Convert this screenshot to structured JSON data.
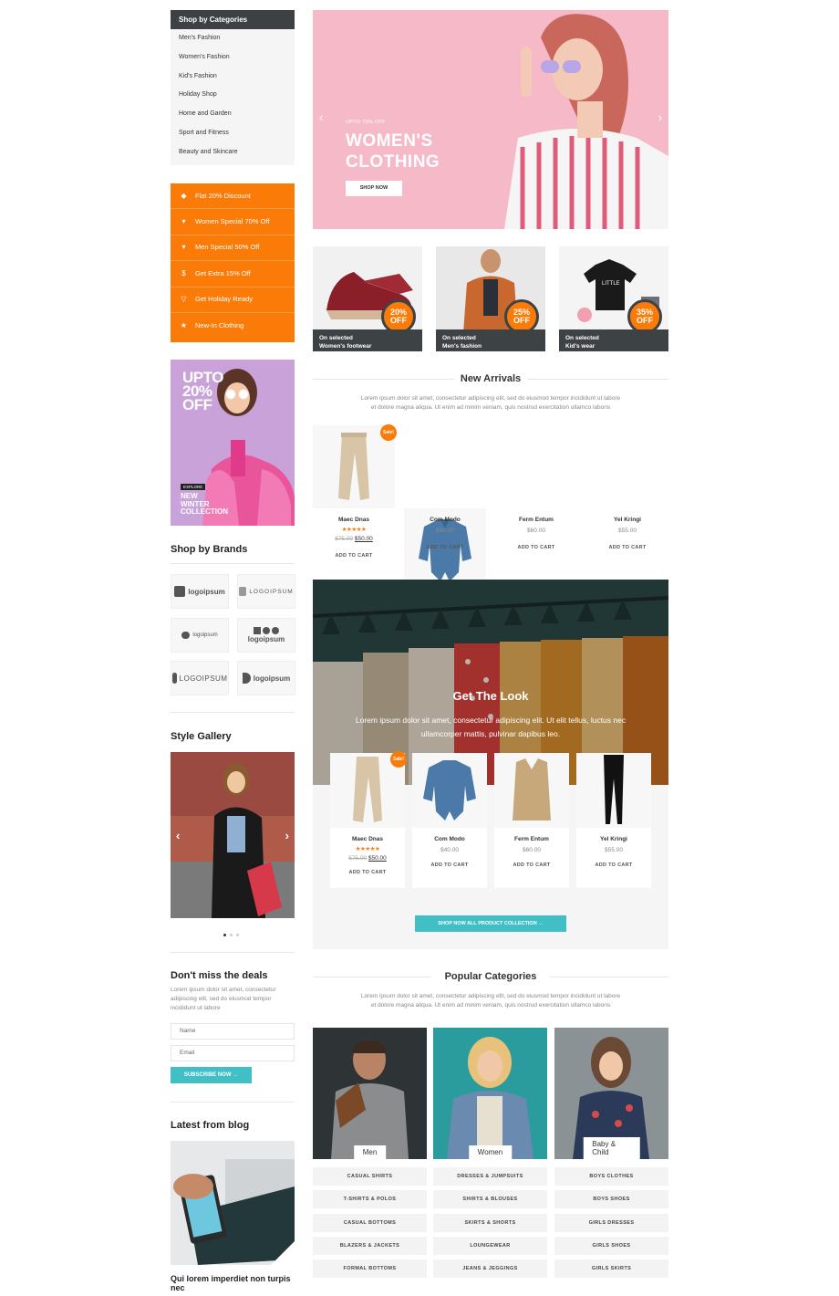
{
  "sidebar": {
    "categories_title": "Shop by Categories",
    "categories": [
      "Men's Fashion",
      "Women's Fashion",
      "Kid's Fashion",
      "Holiday Shop",
      "Home and Garden",
      "Sport and Fitness",
      "Beauty and Skincare"
    ],
    "promos": [
      {
        "icon": "tag-icon",
        "glyph": "◆",
        "label": "Flat 20% Discount"
      },
      {
        "icon": "basket-icon",
        "glyph": "▾",
        "label": "Women Special 70% Off"
      },
      {
        "icon": "basket-icon",
        "glyph": "▾",
        "label": "Men Special 50% Off"
      },
      {
        "icon": "dollar-icon",
        "glyph": "$",
        "label": "Get Extra 15% Off"
      },
      {
        "icon": "cocktail-icon",
        "glyph": "▽",
        "label": "Get Holiday Ready"
      },
      {
        "icon": "star-icon",
        "glyph": "★",
        "label": "New-In Clothing"
      }
    ],
    "banner": {
      "text": "UPTO 20% OFF",
      "line1": "UPTO",
      "line2": "20%",
      "line3": "OFF",
      "explore": "EXPLORE",
      "collection_l1": "NEW",
      "collection_l2": "WINTER",
      "collection_l3": "COLLECTION"
    },
    "brands_title": "Shop by Brands",
    "brands": [
      "logoipsum",
      "LOGOIPSUM",
      "logoipsum",
      "logoipsum",
      "LOGOIPSUM",
      "logoipsum"
    ],
    "gallery_title": "Style Gallery",
    "deals_title": "Don't miss the deals",
    "deals_text": "Lorem ipsum dolor sit amet, consectetur adipiscing elit, sed do eiusmod tempor incididunt ut labore",
    "name_placeholder": "Name",
    "email_placeholder": "Email",
    "subscribe": "SUBSCRIBE NOW →",
    "blog_title": "Latest from blog",
    "blog_post": "Qui lorem imperdiet non turpis nec"
  },
  "hero": {
    "small": "UPTO 70% OFF",
    "title_l1": "WOMEN'S",
    "title_l2": "CLOTHING",
    "button": "SHOP NOW"
  },
  "tiles": [
    {
      "pct": "20%",
      "off": "OFF",
      "l1": "On selected",
      "l2": "Women's footwear"
    },
    {
      "pct": "25%",
      "off": "OFF",
      "l1": "On selected",
      "l2": "Men's fashion"
    },
    {
      "pct": "35%",
      "off": "OFF",
      "l1": "On selected",
      "l2": "Kid's wear"
    }
  ],
  "arrivals": {
    "title": "New Arrivals",
    "desc_l1": "Lorem ipsum dolor sit amet, consectetur adipiscing elit, sed do eiusmod tempor incididunt ut labore",
    "desc_l2": "et dolore magna aliqua. Ut enim ad minim veniam, quis nostrud exercitation ullamco laboris"
  },
  "products": [
    {
      "name": "Maec Dnas",
      "price": "$50.00",
      "old": "$75.00",
      "sale": "Sale!",
      "stars": "★★★★★",
      "cart": "ADD TO CART"
    },
    {
      "name": "Com Modo",
      "price": "$40.00",
      "cart": "ADD TO CART"
    },
    {
      "name": "Ferm Entum",
      "price": "$60.00",
      "cart": "ADD TO CART"
    },
    {
      "name": "Yel Kringi",
      "price": "$55.00",
      "cart": "ADD TO CART"
    }
  ],
  "look": {
    "title": "Get The Look",
    "desc_l1": "Lorem ipsum dolor sit amet, consectetur adipiscing elit. Ut elit tellus, luctus nec",
    "desc_l2": "ullamcorper mattis, pulvinar dapibus leo.",
    "button": "SHOP NOW ALL PRODUCT COLLECTION →"
  },
  "popular": {
    "title": "Popular Categories",
    "desc_l1": "Lorem ipsum dolor sit amet, consectetur adipiscing elit, sed do eiusmod tempor incididunt ut labore",
    "desc_l2": "et dolore magna aliqua. Ut enim ad minim veniam, quis nostrud exercitation ullamco laboris",
    "columns": [
      {
        "tag": "Men",
        "items": [
          "CASUAL SHIRTS",
          "T-SHIRTS & POLOS",
          "CASUAL BOTTOMS",
          "BLAZERS & JACKETS",
          "FORMAL BOTTOMS"
        ]
      },
      {
        "tag": "Women",
        "items": [
          "DRESSES & JUMPSUITS",
          "SHIRTS & BLOUSES",
          "SKIRTS & SHORTS",
          "LOUNGEWEAR",
          "JEANS & JEGGINGS"
        ]
      },
      {
        "tag": "Baby & Child",
        "items": [
          "BOYS CLOTHES",
          "BOYS SHOES",
          "GIRLS DRESSES",
          "GIRLS SHOES",
          "GIRLS SKIRTS"
        ]
      }
    ]
  },
  "colors": {
    "accent": "#fb7b08",
    "teal": "#41bfc6",
    "dark": "#3d4143",
    "hero": "#f6b9c8"
  }
}
